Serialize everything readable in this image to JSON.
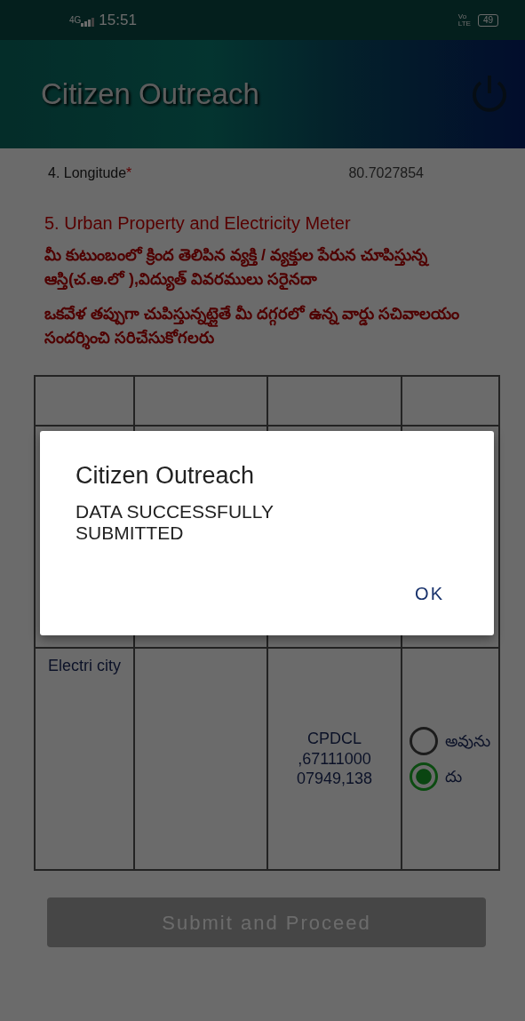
{
  "status_bar": {
    "network": "4G",
    "time": "15:51",
    "volte_top": "Vo",
    "volte_bottom": "LTE",
    "battery": "49"
  },
  "app_bar": {
    "title": "Citizen Outreach"
  },
  "longitude": {
    "label": "4. Longitude",
    "required_mark": "*",
    "value": "80.7027854"
  },
  "section": {
    "title": "5. Urban Property and Electricity Meter",
    "question": "మీ కుటుంబంలో క్రింద తెలిపిన వ్యక్తి / వ్యక్తుల పేరున చూపిస్తున్న ఆస్తి(చ.అ.లో ),విద్యుత్ వివరములు సరైనదా",
    "note": "ఒకవేళ తప్పుగా చుపిస్తున్నట్లైతే మీ దగ్గరలో ఉన్న వార్డు సచివాలయం సందర్శించి సరిచేసుకోగలరు"
  },
  "table": {
    "rows": [
      {
        "type": "Electri city",
        "details": "CPDCL ,67111000 07949,138",
        "options": [
          {
            "label": "అవును",
            "selected": false
          },
          {
            "label": "దు",
            "selected": true
          }
        ]
      }
    ]
  },
  "submit_button": {
    "label": "Submit and Proceed",
    "disabled": true
  },
  "dialog": {
    "title": "Citizen Outreach",
    "message": "DATA SUCCESSFULLY SUBMITTED",
    "ok": "OK"
  }
}
